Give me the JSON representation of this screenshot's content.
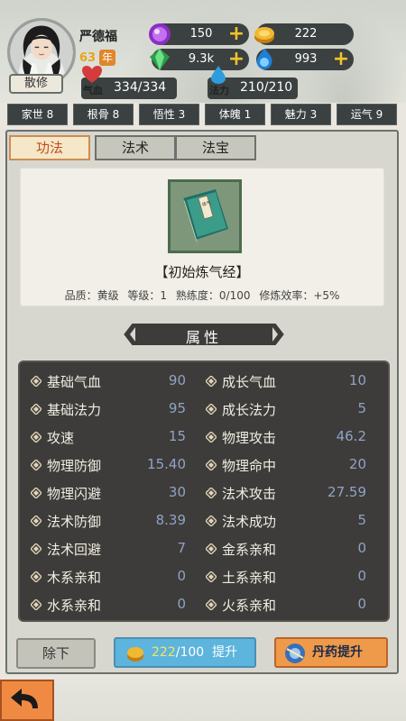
{
  "player": {
    "name": "严德福",
    "age": "63",
    "age_unit": "年",
    "role": "散修"
  },
  "resources": [
    {
      "name": "purple-gem",
      "value": "150",
      "color": "#b04ad8"
    },
    {
      "name": "gold-coin",
      "value": "222",
      "color": "#e7a81c"
    },
    {
      "name": "green-gem",
      "value": "9.3k",
      "color": "#3fbf5a"
    },
    {
      "name": "blue-orb",
      "value": "993",
      "color": "#3aa0ea"
    }
  ],
  "vitals": {
    "hp_label": "气血",
    "hp": "334/334",
    "mp_label": "法力",
    "mp": "210/210"
  },
  "attributes": [
    {
      "label": "家世 8"
    },
    {
      "label": "根骨 8"
    },
    {
      "label": "悟性 3"
    },
    {
      "label": "体魄 1"
    },
    {
      "label": "魅力 3"
    },
    {
      "label": "运气 9"
    }
  ],
  "tabs": [
    {
      "label": "功法",
      "active": true
    },
    {
      "label": "法术",
      "active": false
    },
    {
      "label": "法宝",
      "active": false
    }
  ],
  "item": {
    "name": "【初始炼气经】",
    "quality": "品质：黄级",
    "level": "等级：1",
    "proficiency": "熟练度：0/100",
    "efficiency": "修炼效率：+5%",
    "book_title": "练气"
  },
  "section_title": "属性",
  "stats_left": [
    {
      "label": "基础气血",
      "value": "90"
    },
    {
      "label": "基础法力",
      "value": "95"
    },
    {
      "label": "攻速",
      "value": "15"
    },
    {
      "label": "物理防御",
      "value": "15.40"
    },
    {
      "label": "物理闪避",
      "value": "30"
    },
    {
      "label": "法术防御",
      "value": "8.39"
    },
    {
      "label": "法术回避",
      "value": "7"
    },
    {
      "label": "木系亲和",
      "value": "0"
    },
    {
      "label": "水系亲和",
      "value": "0"
    }
  ],
  "stats_right": [
    {
      "label": "成长气血",
      "value": "10"
    },
    {
      "label": "成长法力",
      "value": "5"
    },
    {
      "label": "物理攻击",
      "value": "46.2"
    },
    {
      "label": "物理命中",
      "value": "20"
    },
    {
      "label": "法术攻击",
      "value": "27.59"
    },
    {
      "label": "法术成功",
      "value": "5"
    },
    {
      "label": "金系亲和",
      "value": "0"
    },
    {
      "label": "土系亲和",
      "value": "0"
    },
    {
      "label": "火系亲和",
      "value": "0"
    }
  ],
  "buttons": {
    "unequip": "除下",
    "upgrade_current": "222",
    "upgrade_required": "/100",
    "upgrade_label": "提升",
    "pill_upgrade": "丹药提升"
  }
}
